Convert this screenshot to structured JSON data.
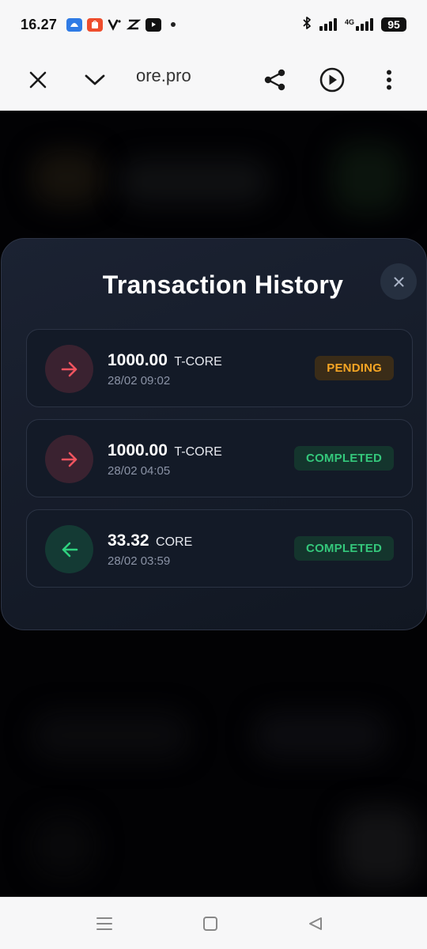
{
  "status_bar": {
    "time": "16.27",
    "app_icons": [
      "app-store-icon",
      "shopee-pay-icon",
      "vidio-icon",
      "capcut-icon",
      "youtube-icon"
    ],
    "network_label": "4G",
    "battery": "95"
  },
  "browser": {
    "url": "ore.pro",
    "icons": [
      "close-icon",
      "chevron-down-icon",
      "share-icon",
      "play-circle-icon",
      "more-vertical-icon"
    ]
  },
  "modal": {
    "title": "Transaction History",
    "transactions": [
      {
        "direction": "outgoing",
        "amount": "1000.00",
        "unit": "T-CORE",
        "date": "28/02 09:02",
        "status": "PENDING"
      },
      {
        "direction": "outgoing",
        "amount": "1000.00",
        "unit": "T-CORE",
        "date": "28/02 04:05",
        "status": "COMPLETED"
      },
      {
        "direction": "incoming",
        "amount": "33.32",
        "unit": "CORE",
        "date": "28/02 03:59",
        "status": "COMPLETED"
      }
    ]
  },
  "colors": {
    "modal_bg": "#171e2c",
    "pending": "#f5a524",
    "completed": "#34c77b",
    "outgoing_arrow": "#f0545f",
    "incoming_arrow": "#2fd17f"
  }
}
